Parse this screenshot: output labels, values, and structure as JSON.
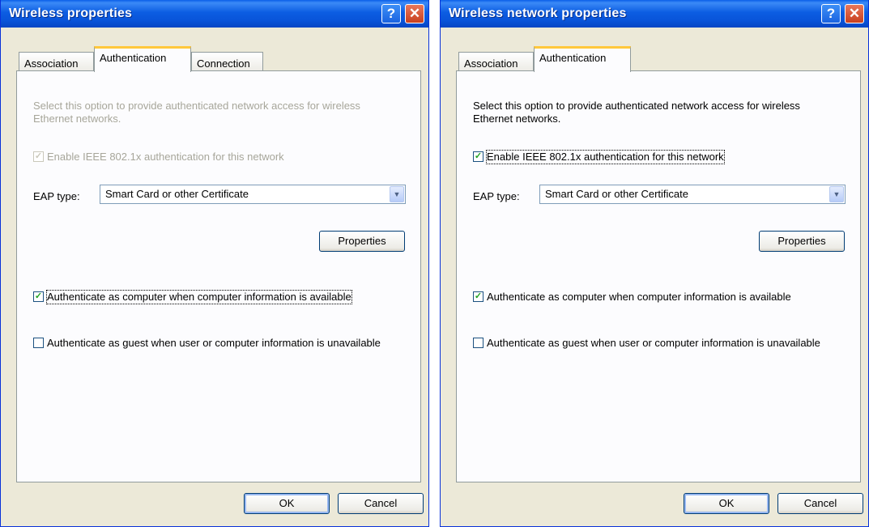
{
  "dialogs": [
    {
      "title": "Wireless properties",
      "help_glyph": "?",
      "close_glyph": "✕",
      "tabs": [
        "Association",
        "Authentication",
        "Connection"
      ],
      "selected_tab": "Authentication",
      "description": "Select this option to provide authenticated network access for wireless Ethernet networks.",
      "enable_8021x_label": "Enable IEEE 802.1x authentication for this network",
      "enable_8021x_checked": true,
      "enable_8021x_disabled": true,
      "eap_label": "EAP type:",
      "eap_value": "Smart Card or other Certificate",
      "properties_label": "Properties",
      "auth_computer_label": "Authenticate as computer when computer information is available",
      "auth_computer_checked": true,
      "auth_guest_label": "Authenticate as guest when user or computer information is unavailable",
      "auth_guest_checked": false,
      "ok_label": "OK",
      "cancel_label": "Cancel"
    },
    {
      "title": "Wireless network properties",
      "help_glyph": "?",
      "close_glyph": "✕",
      "tabs": [
        "Association",
        "Authentication"
      ],
      "selected_tab": "Authentication",
      "description": "Select this option to provide authenticated network access for wireless Ethernet networks.",
      "enable_8021x_label": "Enable IEEE 802.1x authentication for this network",
      "enable_8021x_checked": true,
      "enable_8021x_disabled": false,
      "eap_label": "EAP type:",
      "eap_value": "Smart Card or other Certificate",
      "properties_label": "Properties",
      "auth_computer_label": "Authenticate as computer when computer information is available",
      "auth_computer_checked": true,
      "auth_guest_label": "Authenticate as guest when user or computer information is unavailable",
      "auth_guest_checked": false,
      "ok_label": "OK",
      "cancel_label": "Cancel"
    }
  ],
  "colors": {
    "titlebar": "#0954d9",
    "dialog_bg": "#ece9d8",
    "panel_bg": "#fcfcfe",
    "disabled_text": "#a7a69a",
    "check_green": "#21a121",
    "tab_highlight": "#ffc83c"
  },
  "icons": {
    "help": "question-icon",
    "close": "close-icon",
    "check": "checkmark-icon",
    "dropdown": "chevron-down-icon"
  }
}
